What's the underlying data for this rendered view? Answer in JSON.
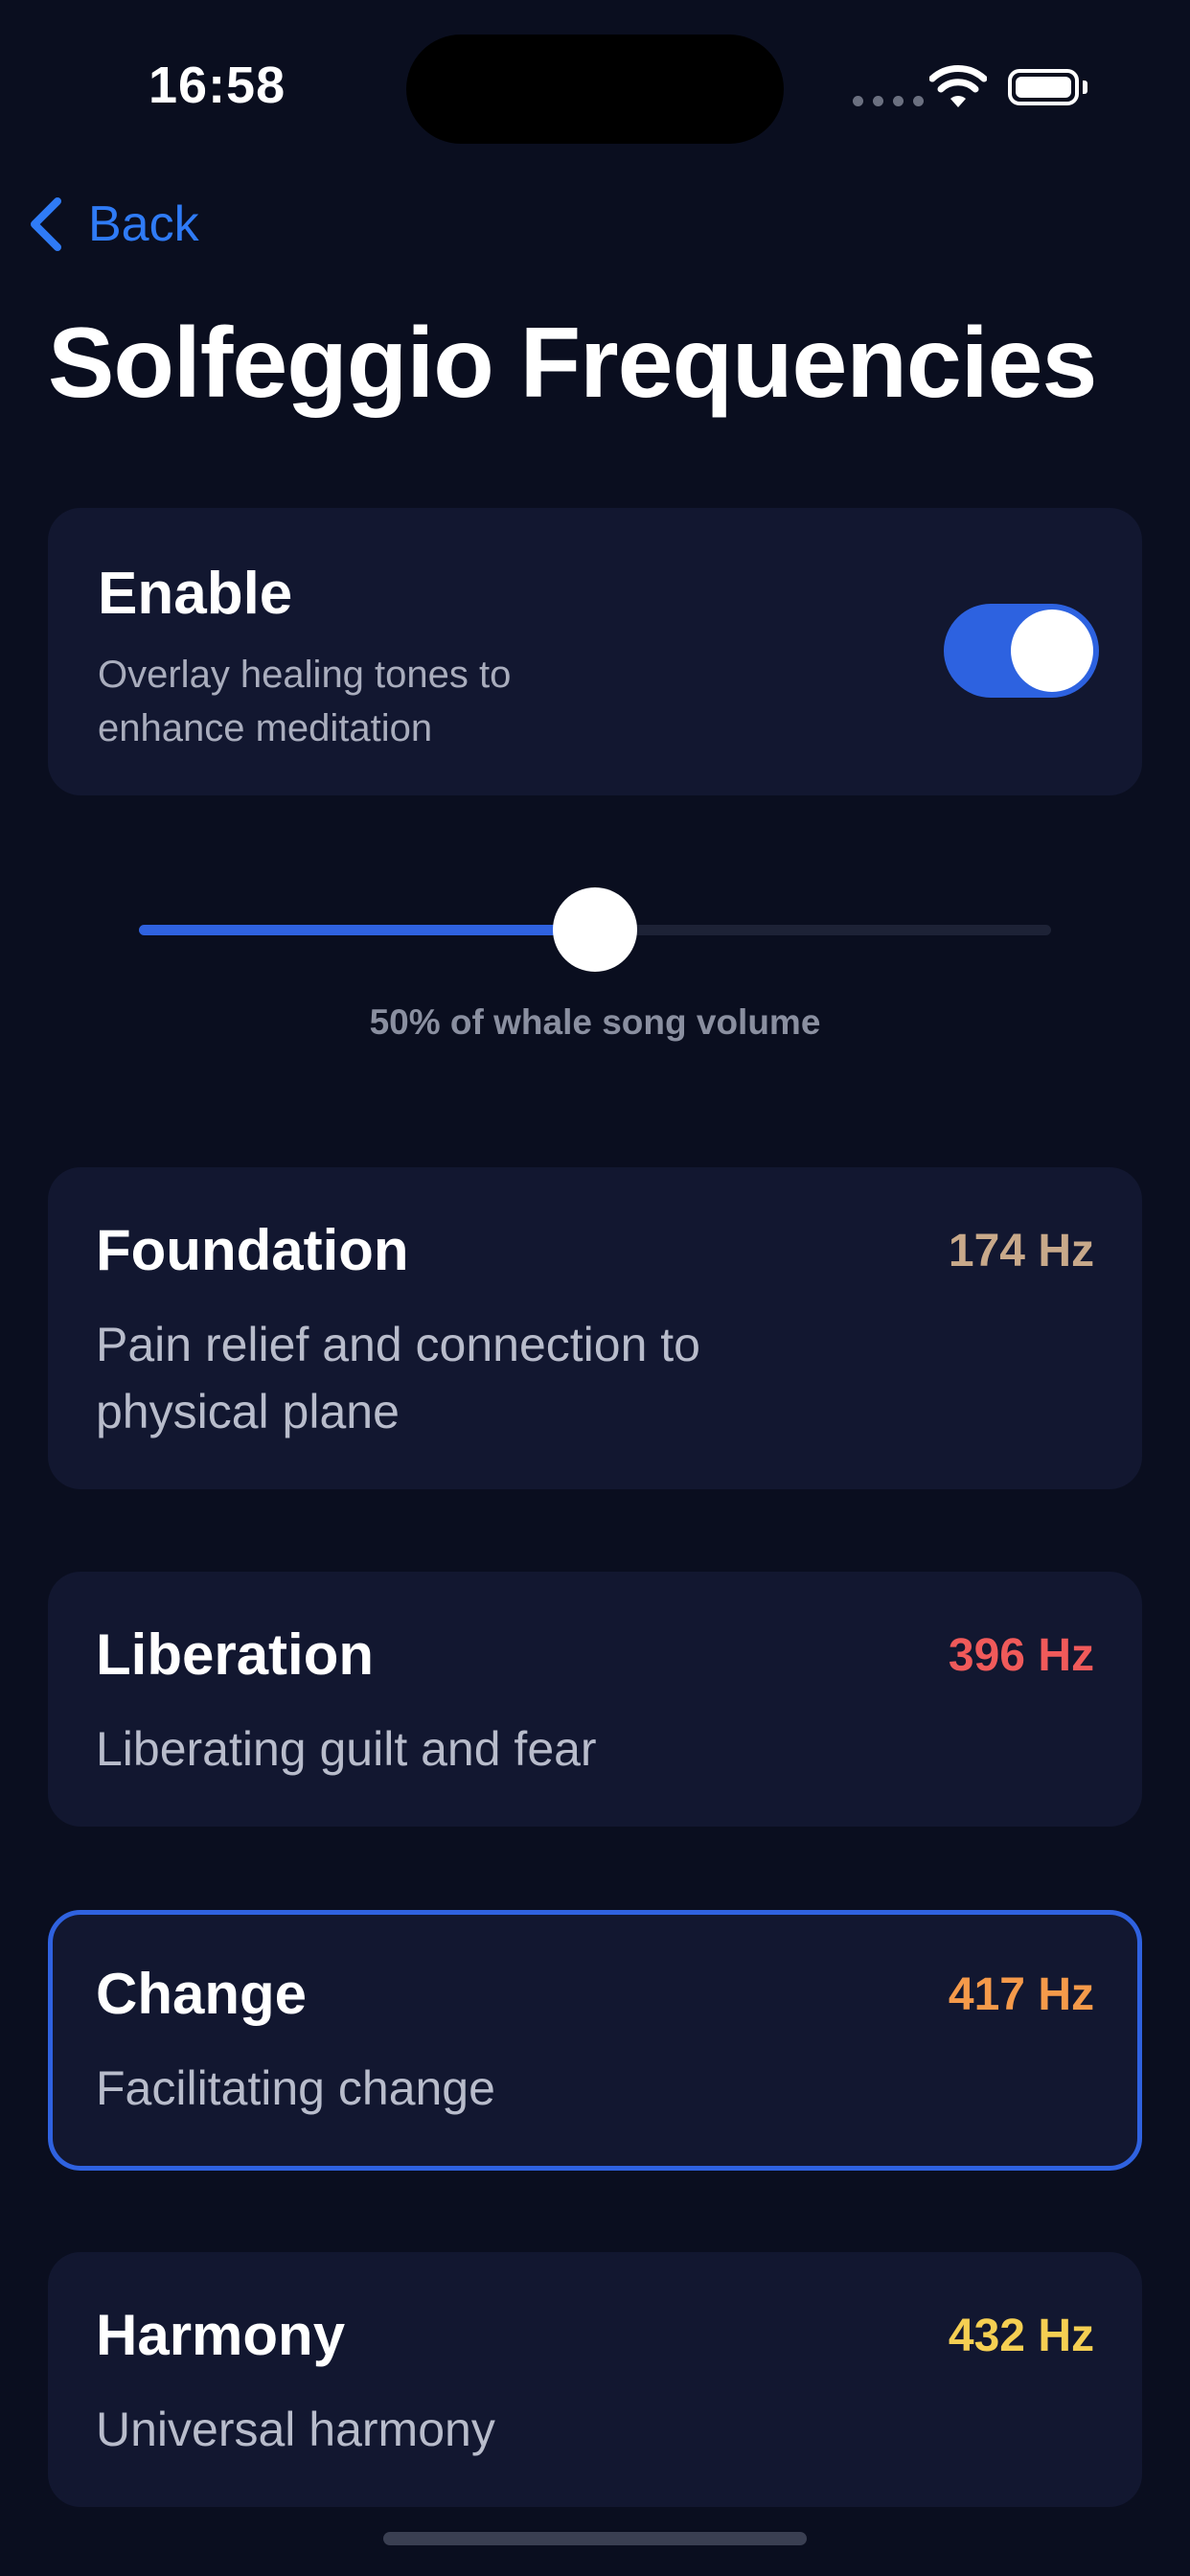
{
  "status_bar": {
    "time": "16:58"
  },
  "nav": {
    "back_label": "Back"
  },
  "page": {
    "title": "Solfeggio Frequencies"
  },
  "enable": {
    "title": "Enable",
    "subtitle": "Overlay healing tones to enhance meditation",
    "toggle_on": true
  },
  "volume": {
    "level_percent": 50,
    "caption": "50% of whale song volume"
  },
  "frequencies": [
    {
      "name": "Foundation",
      "hz": "174 Hz",
      "description": "Pain relief and connection to physical plane",
      "color": "#c8a98a",
      "selected": false
    },
    {
      "name": "Liberation",
      "hz": "396 Hz",
      "description": "Liberating guilt and fear",
      "color": "#f05a5a",
      "selected": false
    },
    {
      "name": "Change",
      "hz": "417 Hz",
      "description": "Facilitating change",
      "color": "#f59a4a",
      "selected": true
    },
    {
      "name": "Harmony",
      "hz": "432 Hz",
      "description": "Universal harmony",
      "color": "#f5cf52",
      "selected": false
    }
  ],
  "colors": {
    "accent": "#2f62e0",
    "link": "#2f7bf6",
    "background": "#0a0e1f",
    "card": "#121730"
  }
}
